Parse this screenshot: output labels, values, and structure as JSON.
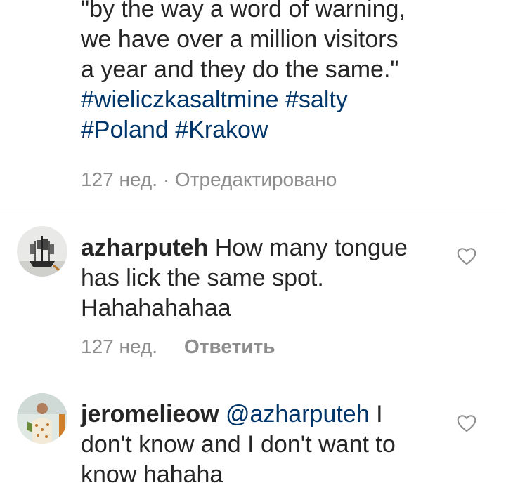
{
  "caption": {
    "line1": "\"by the way a word of warning,",
    "line2": "we have over a million visitors",
    "line3": "a year and they do the same.\"",
    "hashtags_line1": [
      "#wieliczkasaltmine",
      "#salty"
    ],
    "hashtags_line2": [
      "#Poland",
      "#Krakow"
    ],
    "meta": "127 нед. · Отредактировано"
  },
  "comments": [
    {
      "username": "azharputeh",
      "text_line1": "How many tongue",
      "text_line2": "has lick the same spot.",
      "text_line3": "Hahahahahaa",
      "time": "127 нед.",
      "reply_label": "Ответить",
      "avatar_icon": "ship-sketch-avatar",
      "like_icon": "heart-outline-icon"
    },
    {
      "username": "jeromelieow",
      "mention": "@azharputeh",
      "text_line1_rest": "I",
      "text_line2": "don't know and I don't want to",
      "text_line3": "know hahaha",
      "avatar_icon": "person-avatar",
      "like_icon": "heart-outline-icon"
    }
  ],
  "colors": {
    "text": "#262626",
    "link": "#003569",
    "muted": "#8e8e8e",
    "divider": "#dbdbdb"
  }
}
